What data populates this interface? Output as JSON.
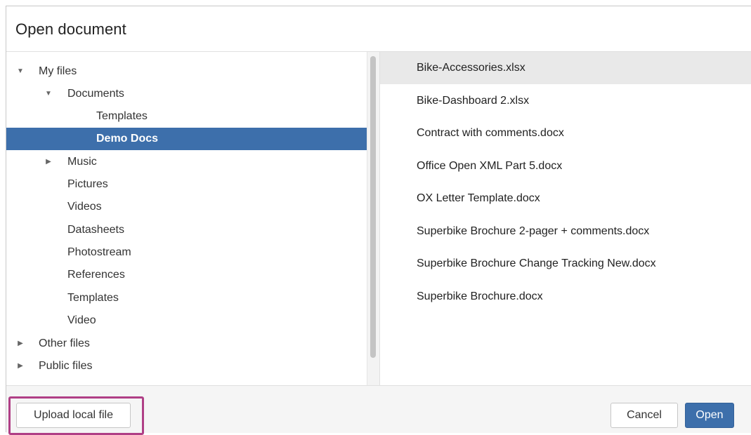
{
  "dialog": {
    "title": "Open document"
  },
  "tree": {
    "items": [
      {
        "label": "My files",
        "caret": "expanded"
      },
      {
        "label": "Documents",
        "caret": "expanded"
      },
      {
        "label": "Templates",
        "caret": "none"
      },
      {
        "label": "Demo Docs",
        "caret": "none",
        "selected": true
      },
      {
        "label": "Music",
        "caret": "collapsed"
      },
      {
        "label": "Pictures",
        "caret": "none"
      },
      {
        "label": "Videos",
        "caret": "none"
      },
      {
        "label": "Datasheets",
        "caret": "none"
      },
      {
        "label": "Photostream",
        "caret": "none"
      },
      {
        "label": "References",
        "caret": "none"
      },
      {
        "label": "Templates",
        "caret": "none"
      },
      {
        "label": "Video",
        "caret": "none"
      },
      {
        "label": "Other files",
        "caret": "collapsed"
      },
      {
        "label": "Public files",
        "caret": "collapsed"
      }
    ]
  },
  "files": {
    "items": [
      {
        "name": "Bike-Accessories.xlsx",
        "selected": true
      },
      {
        "name": "Bike-Dashboard 2.xlsx"
      },
      {
        "name": "Contract with comments.docx"
      },
      {
        "name": "Office Open XML Part 5.docx"
      },
      {
        "name": "OX Letter Template.docx"
      },
      {
        "name": "Superbike Brochure 2-pager + comments.docx"
      },
      {
        "name": "Superbike Brochure Change Tracking New.docx"
      },
      {
        "name": "Superbike Brochure.docx"
      }
    ]
  },
  "footer": {
    "upload_label": "Upload local file",
    "cancel_label": "Cancel",
    "open_label": "Open"
  },
  "colors": {
    "primary": "#3d6fab",
    "highlight_outline": "#b03f86",
    "selected_file_bg": "#e9e9e9"
  },
  "icons": {
    "expanded": "caret-down-icon",
    "collapsed": "caret-right-icon"
  }
}
